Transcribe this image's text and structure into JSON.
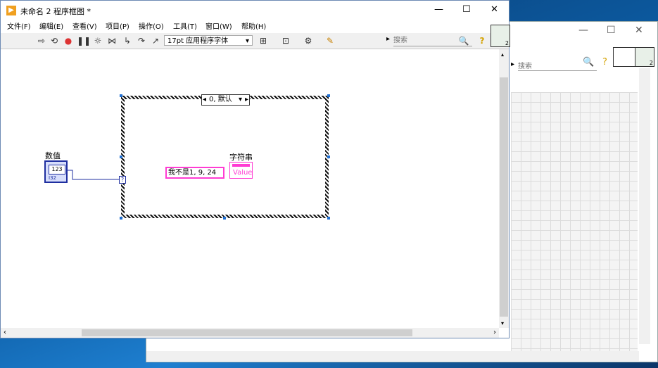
{
  "back_window": {
    "search_placeholder": "搜索",
    "search_arrow": "▸",
    "connector_badge": "2"
  },
  "main_window": {
    "title": "未命名 2 程序框图 *",
    "menu": [
      "文件(F)",
      "编辑(E)",
      "查看(V)",
      "项目(P)",
      "操作(O)",
      "工具(T)",
      "窗口(W)",
      "帮助(H)"
    ],
    "font_select": "17pt 应用程序字体",
    "search_placeholder": "搜索",
    "search_arrow": "▸",
    "connector_badge": "2"
  },
  "diagram": {
    "case_selector": "0, 默认",
    "numeric_label": "数值",
    "numeric_type": "I32",
    "string_label": "字符串",
    "string_constant": "我不是1, 9, 24",
    "indicator_value": "Value",
    "selector_terminal": "?"
  },
  "icons": [
    "run-arrow-icon",
    "run-continuous-icon",
    "abort-icon",
    "pause-icon",
    "highlight-execution-icon",
    "retain-wire-values-icon",
    "step-into-icon",
    "step-over-icon",
    "step-out-icon",
    "align-icon",
    "distribute-icon",
    "reorder-icon",
    "cleanup-icon",
    "search-icon",
    "help-icon"
  ],
  "colors": {
    "accent": "#1f6fd2",
    "string_wire": "#ff3cd3",
    "numeric_wire": "#1f2fa0"
  }
}
